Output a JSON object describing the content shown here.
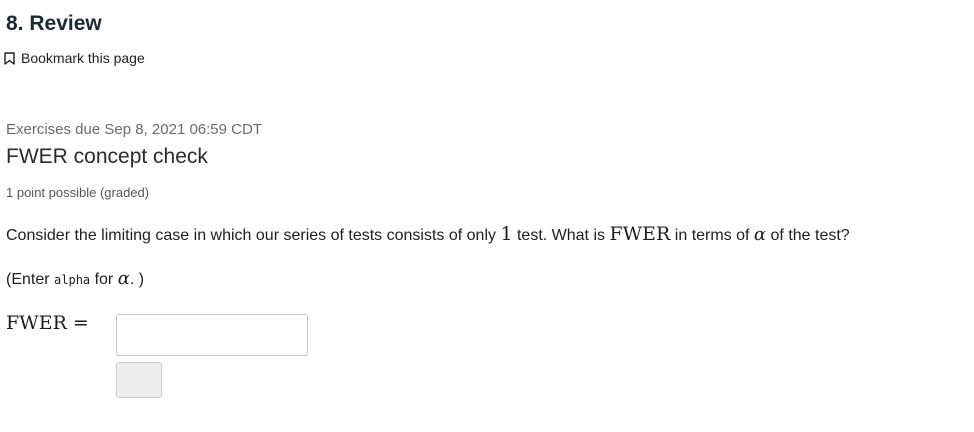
{
  "page": {
    "title": "8. Review"
  },
  "bookmark": {
    "label": "Bookmark this page",
    "icon": "bookmark-icon"
  },
  "problem": {
    "due": "Exercises due Sep 8, 2021 06:59 CDT",
    "title": "FWER concept check",
    "points": "1 point possible (graded)",
    "question": {
      "part1": "Consider the limiting case in which our series of tests consists of only ",
      "num": "1",
      "part2": " test. What is ",
      "term": "FWER",
      "part3": " in terms of ",
      "symbol": "α",
      "part4": " of the test?"
    },
    "hint": {
      "part1": "(Enter ",
      "code": "alpha",
      "part2": " for ",
      "symbol": "α",
      "part3": ". )"
    },
    "answer": {
      "label": "FWER =",
      "value": "",
      "placeholder": ""
    },
    "submit_label": ""
  }
}
